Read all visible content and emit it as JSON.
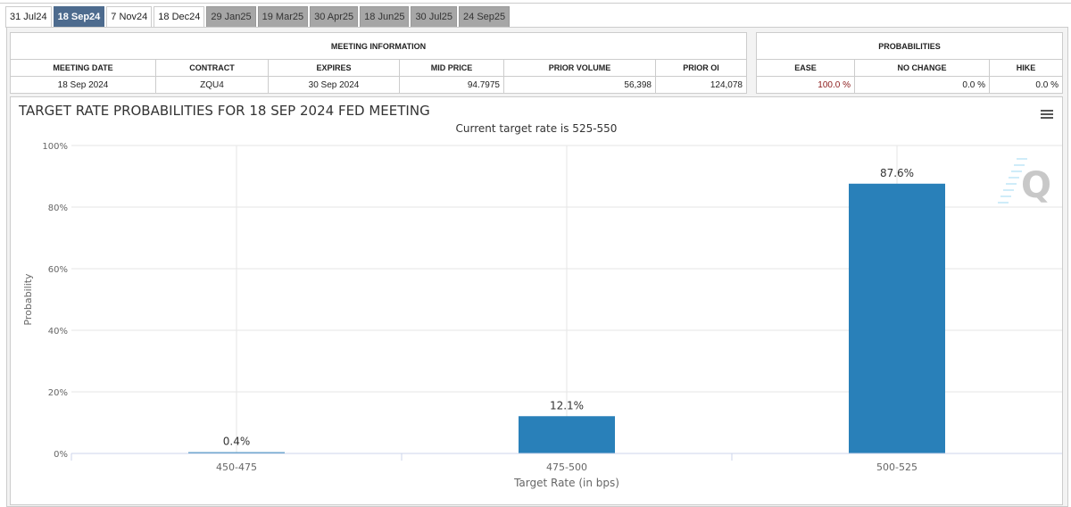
{
  "tabs": [
    {
      "label": "31 Jul24",
      "state": "normal"
    },
    {
      "label": "18 Sep24",
      "state": "active"
    },
    {
      "label": "7 Nov24",
      "state": "normal"
    },
    {
      "label": "18 Dec24",
      "state": "normal"
    },
    {
      "label": "29 Jan25",
      "state": "disabled"
    },
    {
      "label": "19 Mar25",
      "state": "disabled"
    },
    {
      "label": "30 Apr25",
      "state": "disabled"
    },
    {
      "label": "18 Jun25",
      "state": "disabled"
    },
    {
      "label": "30 Jul25",
      "state": "disabled"
    },
    {
      "label": "24 Sep25",
      "state": "disabled"
    }
  ],
  "meeting": {
    "title": "MEETING INFORMATION",
    "headers": [
      "MEETING DATE",
      "CONTRACT",
      "EXPIRES",
      "MID PRICE",
      "PRIOR VOLUME",
      "PRIOR OI"
    ],
    "values": [
      "18 Sep 2024",
      "ZQU4",
      "30 Sep 2024",
      "94.7975",
      "56,398",
      "124,078"
    ]
  },
  "probabilities": {
    "title": "PROBABILITIES",
    "headers": [
      "EASE",
      "NO CHANGE",
      "HIKE"
    ],
    "values": [
      "100.0 %",
      "0.0 %",
      "0.0 %"
    ],
    "ease_color": "#8b1a1a"
  },
  "chart_data": {
    "type": "bar",
    "title": "TARGET RATE PROBABILITIES FOR 18 SEP 2024 FED MEETING",
    "subtitle": "Current target rate is 525-550",
    "xlabel": "Target Rate (in bps)",
    "ylabel": "Probability",
    "categories": [
      "450-475",
      "475-500",
      "500-525"
    ],
    "values": [
      0.4,
      12.1,
      87.6
    ],
    "data_labels": [
      "0.4%",
      "12.1%",
      "87.6%"
    ],
    "yticks": [
      "0%",
      "20%",
      "40%",
      "60%",
      "80%",
      "100%"
    ],
    "ylim": [
      0,
      100
    ],
    "bar_color": "#2980b9",
    "grid": true
  }
}
